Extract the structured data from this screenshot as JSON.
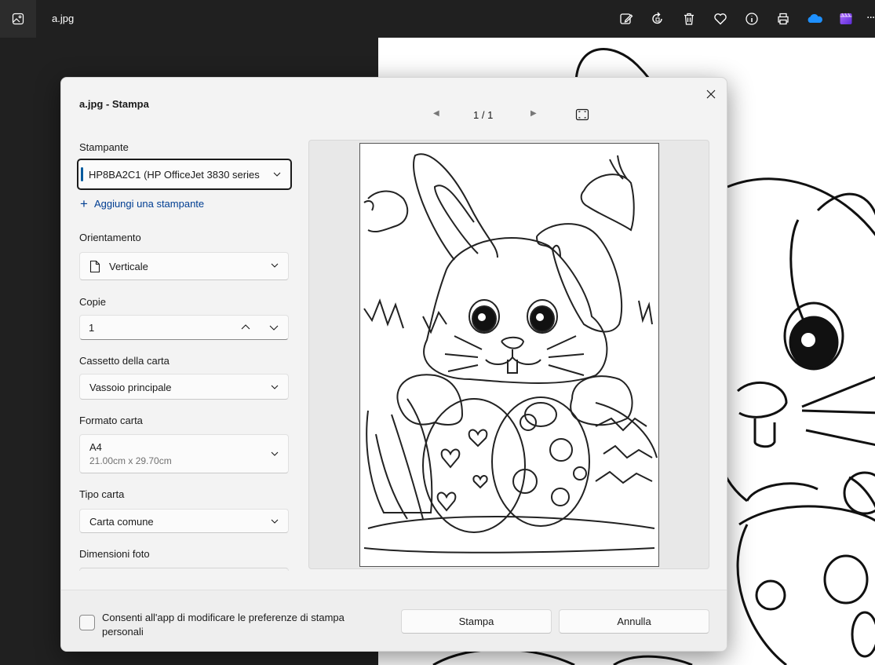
{
  "app": {
    "filename": "a.jpg",
    "toolbar_icons": [
      "photos-app-icon",
      "edit-icon",
      "rotate-icon",
      "delete-icon",
      "favorite-icon",
      "info-icon",
      "print-icon",
      "onedrive-icon",
      "clipchamp-icon",
      "more-icon"
    ],
    "more_label": "..."
  },
  "dialog": {
    "title": "a.jpg - Stampa",
    "pager": {
      "current": "1 / 1"
    },
    "printer": {
      "label": "Stampante",
      "value": "HP8BA2C1 (HP OfficeJet 3830 series)"
    },
    "add_printer": "Aggiungi una stampante",
    "orientation": {
      "label": "Orientamento",
      "value": "Verticale"
    },
    "copies": {
      "label": "Copie",
      "value": "1"
    },
    "paper_tray": {
      "label": "Cassetto della carta",
      "value": "Vassoio principale"
    },
    "paper_size": {
      "label": "Formato carta",
      "value": "A4",
      "detail": "21.00cm x 29.70cm"
    },
    "paper_type": {
      "label": "Tipo carta",
      "value": "Carta comune"
    },
    "photo_size": {
      "label": "Dimensioni foto"
    },
    "footer": {
      "checkbox_label": "Consenti all'app di modificare le preferenze di stampa personali",
      "print_button": "Stampa",
      "cancel_button": "Annulla"
    }
  }
}
